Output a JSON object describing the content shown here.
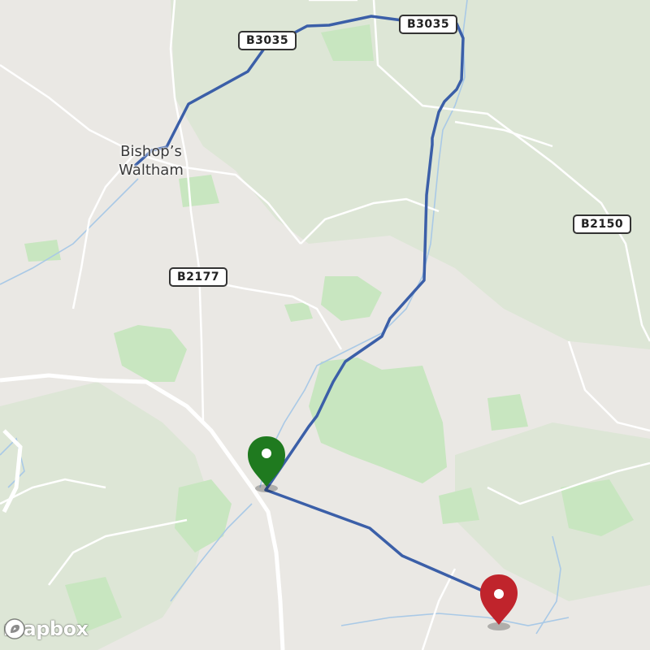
{
  "map": {
    "place_label": [
      "Bishop’s",
      "Waltham"
    ],
    "road_labels": [
      "B3035",
      "B3035",
      "B2177",
      "B2150"
    ],
    "attribution_logo": "mapbox",
    "route_color": "#3b5fa8",
    "start_marker_color": "#1f7a1f",
    "end_marker_color": "#c0242c",
    "land_color": "#eae8e4",
    "wood_color": "#c8e6c0",
    "water_color": "#a9c9e6"
  }
}
